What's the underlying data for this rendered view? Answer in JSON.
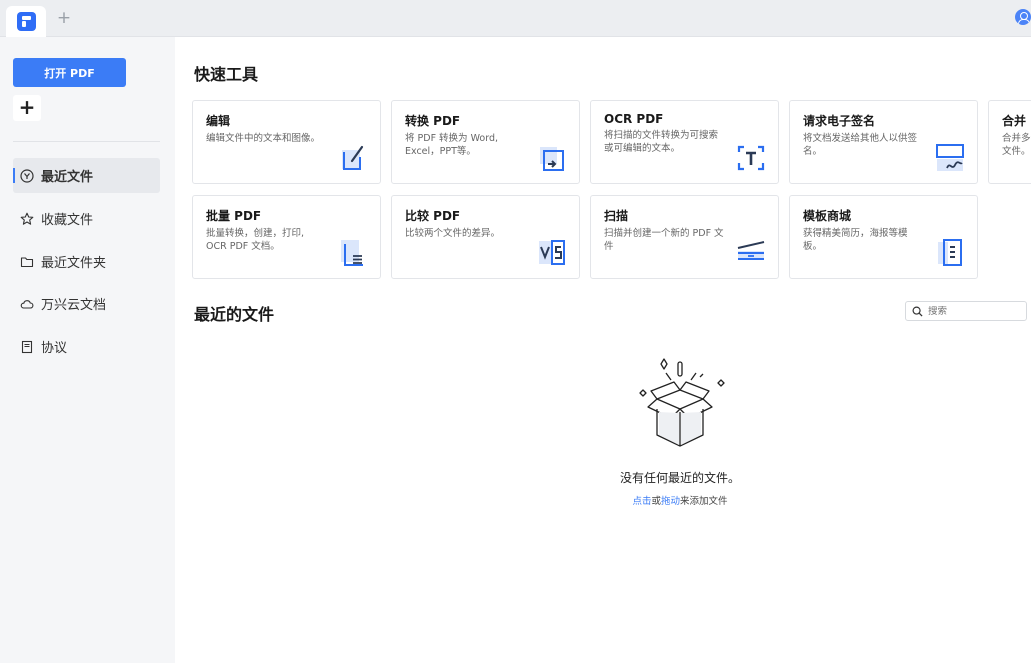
{
  "sidebar": {
    "open_pdf_label": "打开 PDF",
    "add_label": "+",
    "items": [
      {
        "label": "最近文件",
        "icon": "recent-icon",
        "active": true
      },
      {
        "label": "收藏文件",
        "icon": "star-icon",
        "active": false
      },
      {
        "label": "最近文件夹",
        "icon": "folder-icon",
        "active": false
      },
      {
        "label": "万兴云文档",
        "icon": "cloud-icon",
        "active": false
      },
      {
        "label": "协议",
        "icon": "document-icon",
        "active": false
      }
    ]
  },
  "main": {
    "quick_tools_title": "快速工具",
    "tools": [
      {
        "title": "编辑",
        "desc": "编辑文件中的文本和图像。",
        "icon": "edit-icon"
      },
      {
        "title": "转换 PDF",
        "desc": "将 PDF 转换为 Word, Excel，PPT等。",
        "icon": "convert-icon"
      },
      {
        "title": "OCR PDF",
        "desc": "将扫描的文件转换为可搜索或可编辑的文本。",
        "icon": "ocr-icon"
      },
      {
        "title": "请求电子签名",
        "desc": "将文档发送给其他人以供签名。",
        "icon": "signature-icon"
      },
      {
        "title": "合并",
        "desc": "合并多个文件。",
        "icon": "merge-icon"
      },
      {
        "title": "批量 PDF",
        "desc": "批量转换，创建，打印, OCR PDF 文档。",
        "icon": "batch-icon"
      },
      {
        "title": "比较 PDF",
        "desc": "比较两个文件的差异。",
        "icon": "compare-icon"
      },
      {
        "title": "扫描",
        "desc": "扫描并创建一个新的 PDF 文件",
        "icon": "scan-icon"
      },
      {
        "title": "模板商城",
        "desc": "获得精美简历，海报等模板。",
        "icon": "template-icon"
      }
    ],
    "recent_files_title": "最近的文件",
    "search_placeholder": "搜索",
    "empty_text": "没有任何最近的文件。",
    "empty_hint": {
      "click": "点击",
      "or": "或",
      "drag": "拖动",
      "rest": "来添加文件"
    }
  },
  "colors": {
    "accent": "#3b7cf6",
    "icon_dark": "#2b3a55"
  }
}
